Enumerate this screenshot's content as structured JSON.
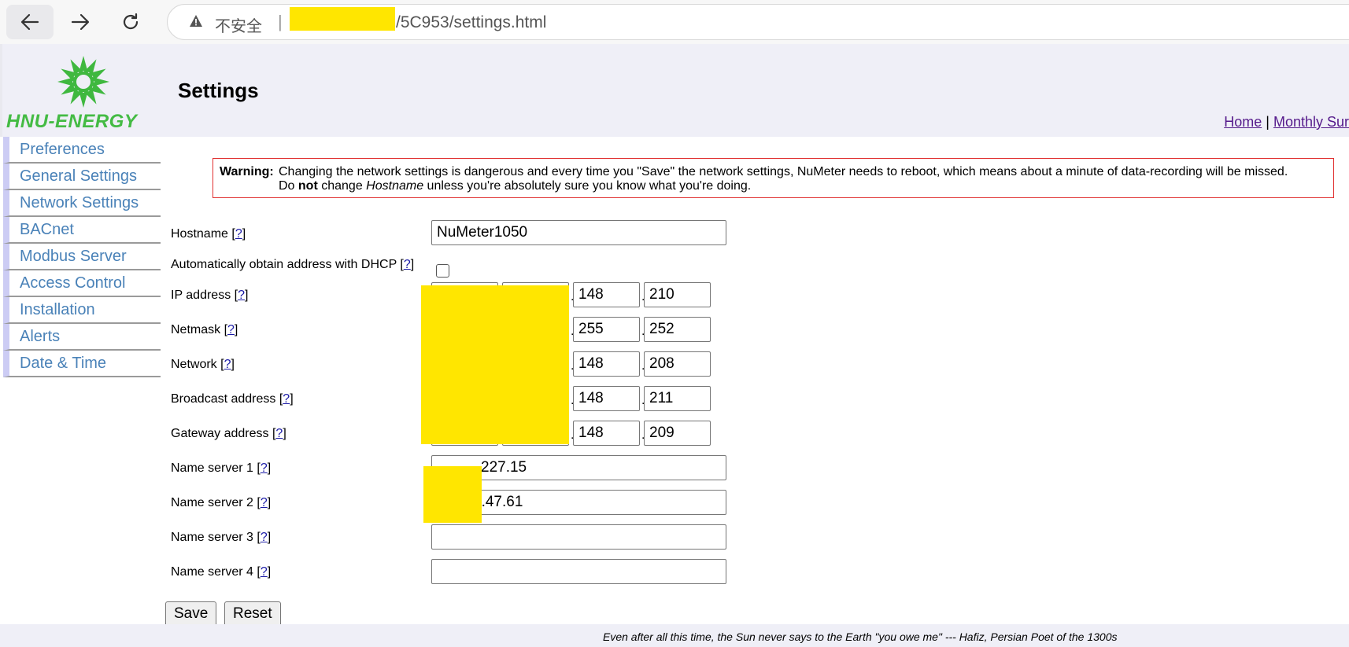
{
  "browser": {
    "security_label": "不安全",
    "separator": "|",
    "url_tail": "/5C953/settings.html"
  },
  "header": {
    "logo_text": "HNU-ENERGY",
    "title": "Settings",
    "links": [
      "Home",
      "Monthly Sur"
    ],
    "link_separator": "|"
  },
  "sidebar": {
    "items": [
      {
        "label": "Preferences"
      },
      {
        "label": "General Settings"
      },
      {
        "label": "Network Settings"
      },
      {
        "label": "BACnet"
      },
      {
        "label": "Modbus Server"
      },
      {
        "label": "Access Control"
      },
      {
        "label": "Installation"
      },
      {
        "label": "Alerts"
      },
      {
        "label": "Date & Time"
      }
    ]
  },
  "warning": {
    "label": "Warning:",
    "line1": "Changing the network settings is dangerous and every time you \"Save\" the network settings, NuMeter needs to reboot, which means about a minute of data-recording will be missed.",
    "line2_pre": "Do ",
    "line2_bold": "not",
    "line2_mid": " change ",
    "line2_italic": "Hostname",
    "line2_post": " unless you're absolutely sure you know what you're doing."
  },
  "help_text": "?",
  "form": {
    "hostname": {
      "label": "Hostname",
      "value": "NuMeter1050"
    },
    "dhcp": {
      "label": "Automatically obtain address with DHCP",
      "checked": false
    },
    "ip_address": {
      "label": "IP address",
      "oct3": "148",
      "oct4": "210"
    },
    "netmask": {
      "label": "Netmask",
      "oct3": "255",
      "oct4": "252"
    },
    "network": {
      "label": "Network",
      "oct3": "148",
      "oct4": "208"
    },
    "broadcast": {
      "label": "Broadcast address",
      "oct3": "148",
      "oct4": "211"
    },
    "gateway": {
      "label": "Gateway address",
      "oct3": "148",
      "oct4": "209"
    },
    "ns1": {
      "label": "Name server 1",
      "value_visible": "227.15"
    },
    "ns2": {
      "label": "Name server 2",
      "value_visible": "3.47.61"
    },
    "ns3": {
      "label": "Name server 3",
      "value": ""
    },
    "ns4": {
      "label": "Name server 4",
      "value": ""
    }
  },
  "buttons": {
    "save": "Save",
    "reset": "Reset"
  },
  "footer": {
    "quote": "Even after all this time, the Sun never says to the Earth \"you owe me\" --- Hafiz, Persian Poet of the 1300s"
  },
  "colors": {
    "header_bg": "#efeff7",
    "nav_link": "#4a82b8",
    "warning_border": "#e03030",
    "logo_green": "#44bb44",
    "redaction": "#ffe600"
  }
}
